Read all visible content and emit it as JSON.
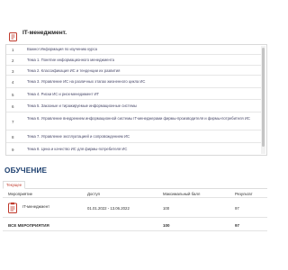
{
  "course": {
    "title": "IT-менеджмент.",
    "topics": [
      {
        "num": "1",
        "text": "Важно! Информация по изучению курса"
      },
      {
        "num": "2",
        "text": "Тема 1. Понятие информационного менеджмента"
      },
      {
        "num": "3",
        "text": "Тема 2. Классификация ИС и тенденции их развития"
      },
      {
        "num": "4",
        "text": "Тема 3. Управление ИС на различных этапах жизненного цикла ИС"
      },
      {
        "num": "5",
        "text": "Тема 4. Риски ИС и риск-менеджмент ИТ"
      },
      {
        "num": "6",
        "text": "Тема 5. Заказные и тиражируемые информационные системы"
      },
      {
        "num": "7",
        "text": "Тема 6. Управление внедрением информационной системы IT-менеджерами фирмы-производителя и фирмы-потребителя ИС"
      },
      {
        "num": "8",
        "text": "Тема 7. Управление эксплуатацией и сопровождением ИС"
      },
      {
        "num": "9",
        "text": "Тема 8. Цена и качество ИС для фирмы-потребителя ИС"
      }
    ]
  },
  "learning": {
    "section_title": "ОБУЧЕНИЕ",
    "tab_current": "Текущее",
    "columns": {
      "event": "Мероприятие",
      "access": "Доступ",
      "max_score": "Максимальный балл",
      "result": "Результат"
    },
    "rows": [
      {
        "event": "IT-менеджмент",
        "access": "01.01.2022 - 13.06.2022",
        "max_score": "100",
        "result": "97"
      }
    ],
    "total": {
      "label": "ВСЕ МЕРОПРИЯТИЯ",
      "max_score": "100",
      "result": "97"
    }
  },
  "colors": {
    "accent_red": "#c0392b",
    "heading_blue": "#1a3d6d"
  }
}
